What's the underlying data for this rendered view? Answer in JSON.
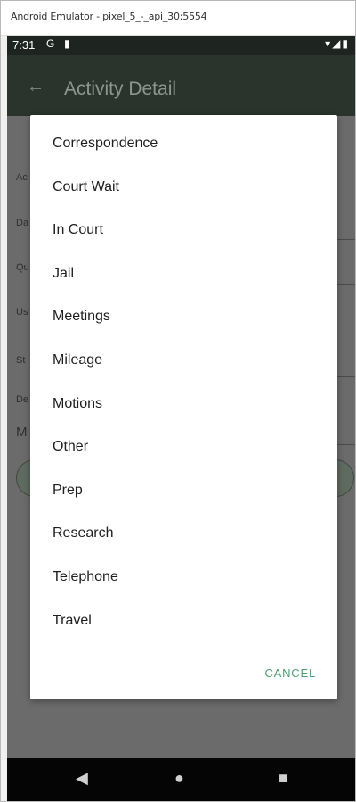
{
  "window": {
    "title": "Android Emulator - pixel_5_-_api_30:5554"
  },
  "status_bar": {
    "time": "7:31",
    "icon_left_1": "G",
    "icon_left_2": "▮",
    "icon_right": "▾◢▮"
  },
  "app_bar": {
    "back_icon": "←",
    "title": "Activity Detail"
  },
  "background_form": {
    "labels": [
      "Ac",
      "Da",
      "Qu",
      "Us",
      "St",
      "De",
      "M"
    ]
  },
  "dialog": {
    "items": [
      {
        "label": "Correspondence"
      },
      {
        "label": "Court Wait"
      },
      {
        "label": "In Court"
      },
      {
        "label": "Jail"
      },
      {
        "label": "Meetings"
      },
      {
        "label": "Mileage"
      },
      {
        "label": "Motions"
      },
      {
        "label": "Other"
      },
      {
        "label": "Prep"
      },
      {
        "label": "Research"
      },
      {
        "label": "Telephone"
      },
      {
        "label": "Travel"
      }
    ],
    "cancel_label": "CANCEL"
  },
  "nav_bar": {
    "back": "◀",
    "home": "●",
    "recents": "■"
  },
  "colors": {
    "accent": "#4f9e72",
    "app_bar": "#2b332d",
    "status_bar": "#1e2420"
  }
}
